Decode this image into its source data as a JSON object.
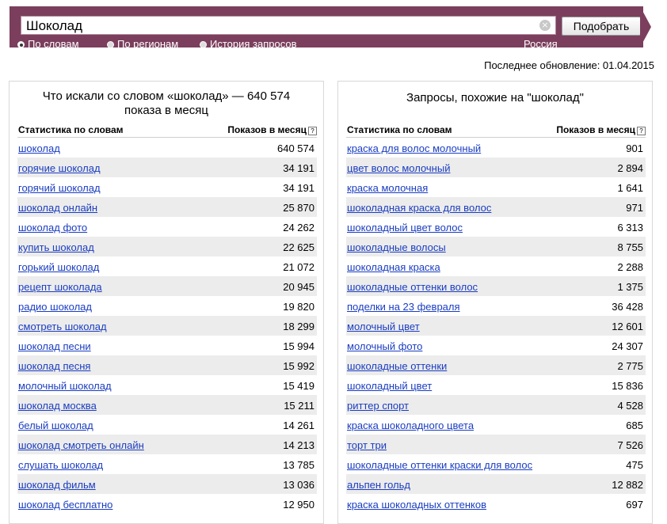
{
  "search": {
    "query": "Шоколад",
    "clear_symbol": "×",
    "submit_label": "Подобрать"
  },
  "modes": [
    {
      "label": "По словам",
      "selected": true
    },
    {
      "label": "По регионам",
      "selected": false
    },
    {
      "label": "История запросов",
      "selected": false
    }
  ],
  "region": "Россия",
  "updated": "Последнее обновление: 01.04.2015",
  "colors": {
    "header": "#7b3f5d",
    "link": "#1a3dc1",
    "stripe": "#ececec"
  },
  "left_panel": {
    "title": "Что искали со словом «шоколад» — 640 574 показа в месяц",
    "col_keyword": "Статистика по словам",
    "col_count": "Показов в месяц",
    "help": "?",
    "rows": [
      {
        "keyword": "шоколад",
        "count": "640 574"
      },
      {
        "keyword": "горячие шоколад",
        "count": "34 191"
      },
      {
        "keyword": "горячий шоколад",
        "count": "34 191"
      },
      {
        "keyword": "шоколад онлайн",
        "count": "25 870"
      },
      {
        "keyword": "шоколад фото",
        "count": "24 262"
      },
      {
        "keyword": "купить шоколад",
        "count": "22 625"
      },
      {
        "keyword": "горький шоколад",
        "count": "21 072"
      },
      {
        "keyword": "рецепт шоколада",
        "count": "20 945"
      },
      {
        "keyword": "радио шоколад",
        "count": "19 820"
      },
      {
        "keyword": "смотреть шоколад",
        "count": "18 299"
      },
      {
        "keyword": "шоколад песни",
        "count": "15 994"
      },
      {
        "keyword": "шоколад песня",
        "count": "15 992"
      },
      {
        "keyword": "молочный шоколад",
        "count": "15 419"
      },
      {
        "keyword": "шоколад москва",
        "count": "15 211"
      },
      {
        "keyword": "белый шоколад",
        "count": "14 261"
      },
      {
        "keyword": "шоколад смотреть онлайн",
        "count": "14 213"
      },
      {
        "keyword": "слушать шоколад",
        "count": "13 785"
      },
      {
        "keyword": "шоколад фильм",
        "count": "13 036"
      },
      {
        "keyword": "шоколад бесплатно",
        "count": "12 950"
      }
    ]
  },
  "right_panel": {
    "title": "Запросы, похожие на \"шоколад\"",
    "col_keyword": "Статистика по словам",
    "col_count": "Показов в месяц",
    "help": "?",
    "rows": [
      {
        "keyword": "краска для волос молочный",
        "count": "901"
      },
      {
        "keyword": "цвет волос молочный",
        "count": "2 894"
      },
      {
        "keyword": "краска молочная",
        "count": "1 641"
      },
      {
        "keyword": "шоколадная краска для волос",
        "count": "971"
      },
      {
        "keyword": "шоколадный цвет волос",
        "count": "6 313"
      },
      {
        "keyword": "шоколадные волосы",
        "count": "8 755"
      },
      {
        "keyword": "шоколадная краска",
        "count": "2 288"
      },
      {
        "keyword": "шоколадные оттенки волос",
        "count": "1 375"
      },
      {
        "keyword": "поделки на 23 февраля",
        "count": "36 428"
      },
      {
        "keyword": "молочный цвет",
        "count": "12 601"
      },
      {
        "keyword": "молочный фото",
        "count": "24 307"
      },
      {
        "keyword": "шоколадные оттенки",
        "count": "2 775"
      },
      {
        "keyword": "шоколадный цвет",
        "count": "15 836"
      },
      {
        "keyword": "риттер спорт",
        "count": "4 528"
      },
      {
        "keyword": "краска шоколадного цвета",
        "count": "685"
      },
      {
        "keyword": "торт три",
        "count": "7 526"
      },
      {
        "keyword": "шоколадные оттенки краски для волос",
        "count": "475"
      },
      {
        "keyword": "альпен гольд",
        "count": "12 882"
      },
      {
        "keyword": "краска шоколадных оттенков",
        "count": "697"
      }
    ]
  }
}
